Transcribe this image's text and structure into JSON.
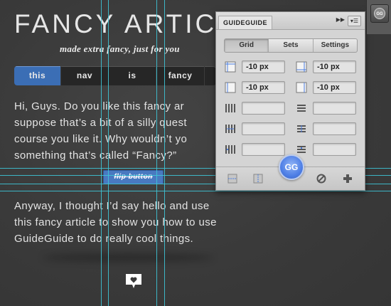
{
  "article": {
    "title": "FANCY ARTIC",
    "subtitle": "made extra fancy, just for you",
    "nav": [
      "this",
      "nav",
      "is",
      "fancy"
    ],
    "paragraph1": "Hi, Guys. Do you like this fancy ar\nsuppose that’s a bit of a silly quest\ncourse you like it. Why wouldn’t yo\nsomething that’s called “Fancy?”",
    "flip_button": "flip button",
    "paragraph2": "Anyway, I thought I’d say hello and use\nthis fancy article to show you how to use\nGuideGuide to do really cool things."
  },
  "panel": {
    "title": "GUIDEGUIDE",
    "tabs": [
      "Grid",
      "Sets",
      "Settings"
    ],
    "active_tab": "Grid",
    "margin_fields": {
      "top_left": "-10 px",
      "top_right": "-10 px",
      "bottom_left": "-10 px",
      "bottom_right": "-10 px"
    },
    "grid_fields": {
      "col_count": "",
      "row_count": "",
      "col_width": "",
      "row_width": "",
      "col_gutter": "",
      "row_gutter": ""
    },
    "gg_button": "GG"
  },
  "dock": {
    "gg_icon_label": "GG"
  },
  "colors": {
    "accent": "#3b6eb5",
    "guide": "#3ec4d6",
    "background": "#3a3a3a"
  }
}
